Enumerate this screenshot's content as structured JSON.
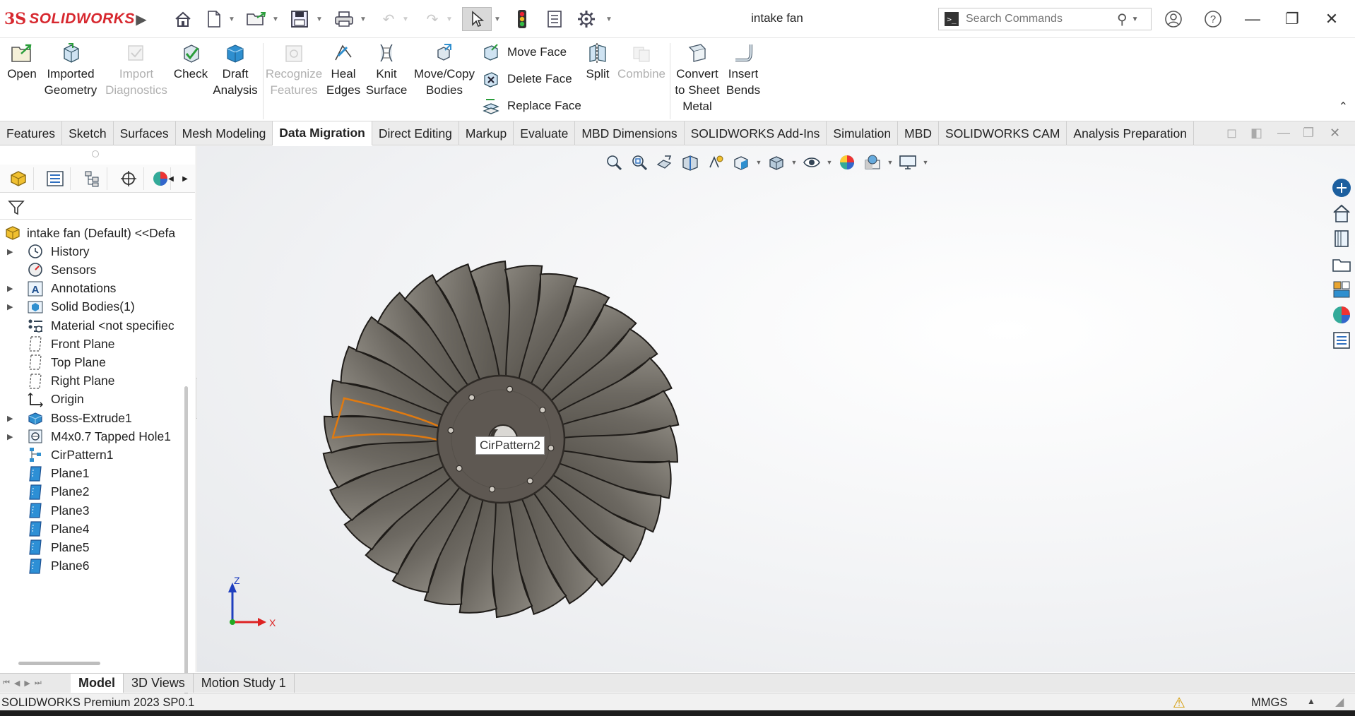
{
  "app": {
    "logo_prefix": "3S",
    "logo_text": "SOLIDWORKS",
    "document_title": "intake fan",
    "search_placeholder": "Search Commands"
  },
  "ribbon": {
    "buttons": [
      {
        "label1": "Open",
        "label2": "",
        "enabled": true
      },
      {
        "label1": "Imported",
        "label2": "Geometry",
        "enabled": true
      },
      {
        "label1": "Import",
        "label2": "Diagnostics",
        "enabled": false
      },
      {
        "label1": "Check",
        "label2": "",
        "enabled": true
      },
      {
        "label1": "Draft",
        "label2": "Analysis",
        "enabled": true
      },
      {
        "label1": "Recognize",
        "label2": "Features",
        "enabled": false
      },
      {
        "label1": "Heal",
        "label2": "Edges",
        "enabled": true
      },
      {
        "label1": "Knit",
        "label2": "Surface",
        "enabled": true
      },
      {
        "label1": "Move/Copy",
        "label2": "Bodies",
        "enabled": true
      },
      {
        "label1": "Split",
        "label2": "",
        "enabled": true
      },
      {
        "label1": "Combine",
        "label2": "",
        "enabled": false
      },
      {
        "label1": "Convert",
        "label2": "to Sheet",
        "label3": "Metal",
        "enabled": true
      },
      {
        "label1": "Insert",
        "label2": "Bends",
        "enabled": true
      }
    ],
    "face_tools": [
      "Move Face",
      "Delete Face",
      "Replace Face"
    ]
  },
  "tabs": [
    "Features",
    "Sketch",
    "Surfaces",
    "Mesh Modeling",
    "Data Migration",
    "Direct Editing",
    "Markup",
    "Evaluate",
    "MBD Dimensions",
    "SOLIDWORKS Add-Ins",
    "Simulation",
    "MBD",
    "SOLIDWORKS CAM",
    "Analysis Preparation"
  ],
  "active_tab": "Data Migration",
  "tree": {
    "root": "intake fan (Default) <<Defa",
    "items": [
      {
        "label": "History",
        "expandable": true,
        "icon": "history-icon"
      },
      {
        "label": "Sensors",
        "expandable": false,
        "icon": "sensors-icon"
      },
      {
        "label": "Annotations",
        "expandable": true,
        "icon": "annotations-icon"
      },
      {
        "label": "Solid Bodies(1)",
        "expandable": true,
        "icon": "solid-bodies-icon"
      },
      {
        "label": "Material <not specifiec",
        "expandable": false,
        "icon": "material-icon"
      },
      {
        "label": "Front Plane",
        "expandable": false,
        "icon": "plane-icon"
      },
      {
        "label": "Top Plane",
        "expandable": false,
        "icon": "plane-icon"
      },
      {
        "label": "Right Plane",
        "expandable": false,
        "icon": "plane-icon"
      },
      {
        "label": "Origin",
        "expandable": false,
        "icon": "origin-icon"
      },
      {
        "label": "Boss-Extrude1",
        "expandable": true,
        "icon": "extrude-icon"
      },
      {
        "label": "M4x0.7 Tapped Hole1",
        "expandable": true,
        "icon": "hole-icon"
      },
      {
        "label": "CirPattern1",
        "expandable": false,
        "icon": "pattern-icon"
      },
      {
        "label": "Plane1",
        "expandable": false,
        "icon": "ref-plane-icon"
      },
      {
        "label": "Plane2",
        "expandable": false,
        "icon": "ref-plane-icon"
      },
      {
        "label": "Plane3",
        "expandable": false,
        "icon": "ref-plane-icon"
      },
      {
        "label": "Plane4",
        "expandable": false,
        "icon": "ref-plane-icon"
      },
      {
        "label": "Plane5",
        "expandable": false,
        "icon": "ref-plane-icon"
      },
      {
        "label": "Plane6",
        "expandable": false,
        "icon": "ref-plane-icon"
      }
    ]
  },
  "viewport": {
    "tooltip": "CirPattern2",
    "triad": {
      "z": "Z",
      "x": "X"
    },
    "blade_count": 30
  },
  "bottom_tabs": [
    "Model",
    "3D Views",
    "Motion Study 1"
  ],
  "active_bottom_tab": "Model",
  "status": {
    "product": "SOLIDWORKS Premium 2023 SP0.1",
    "units": "MMGS"
  },
  "colors": {
    "brand_red": "#d7282f",
    "blade_fill": "#75716a",
    "hub_fill": "#5e5852",
    "highlight_orange": "#e07a10",
    "plane_blue": "#2d8fd5"
  }
}
